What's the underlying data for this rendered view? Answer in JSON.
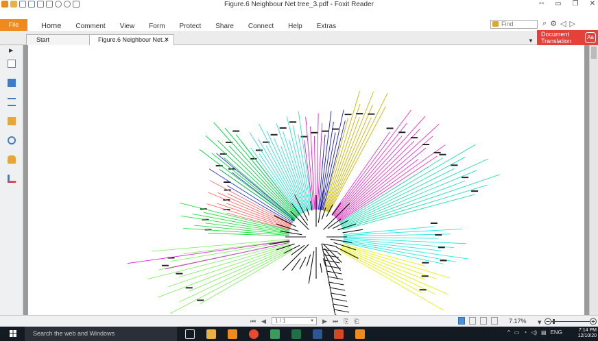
{
  "window": {
    "title": "Figure.6 Neighbour Net tree_3.pdf - Foxit Reader",
    "controls": [
      "minimize",
      "restore",
      "close"
    ]
  },
  "menu": {
    "file": "File",
    "items": [
      "Home",
      "Comment",
      "View",
      "Form",
      "Protect",
      "Share",
      "Connect",
      "Help",
      "Extras"
    ]
  },
  "find": {
    "placeholder": "Find"
  },
  "doc_translation": {
    "line1": "Document",
    "line2": "Translation",
    "badge": "Aa"
  },
  "tabs": [
    {
      "label": "Start"
    },
    {
      "label": "Figure.6 Neighbour Net...",
      "close": "×"
    }
  ],
  "sidebar": {
    "icons": [
      "pages-icon",
      "copy-icon",
      "layers-icon",
      "comments-icon",
      "attachments-icon",
      "security-icon",
      "signature-icon"
    ]
  },
  "statusbar": {
    "page_value": "1 / 1",
    "zoom": "7.17%"
  },
  "taskbar": {
    "search_placeholder": "Search the web and Windows",
    "lang": "ENG",
    "time": "7:14 PM",
    "date": "12/10/20"
  },
  "colors": {
    "file_tab": "#f08a1c",
    "doc_translation": "#e5413a",
    "taskbar": "#141a22",
    "viewer_bg": "#9a9a9a"
  }
}
